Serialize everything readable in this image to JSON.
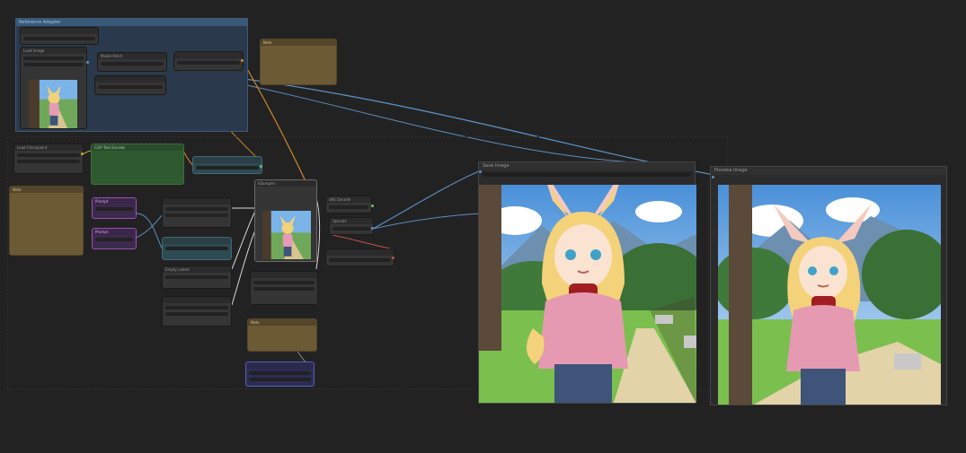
{
  "canvas": {
    "background": "#222222"
  },
  "group": {
    "title": "Reference Adapter"
  },
  "nodes": {
    "load_image": "Load Image",
    "note_top": "Note",
    "checkpoint": "Load Checkpoint",
    "clip_text_pos": "CLIP Text Encode",
    "model_patch": "Model Patch",
    "note_left": "Note",
    "prompt_a": "Prompt",
    "prompt_b": "Prompt",
    "ksampler": "KSampler",
    "vae_decode": "VAE Decode",
    "empty_latent": "Empty Latent",
    "note_bottom": "Note",
    "upscale": "Upscale",
    "save_image": "Save Image",
    "preview_image": "Preview Image"
  },
  "colors": {
    "wire_blue": "#5a8fc0",
    "wire_orange": "#d08a2a",
    "wire_white": "#d8d8d8",
    "wire_red": "#c05050",
    "slot_green": "#6fbf6f",
    "slot_orange": "#d08a2a"
  }
}
